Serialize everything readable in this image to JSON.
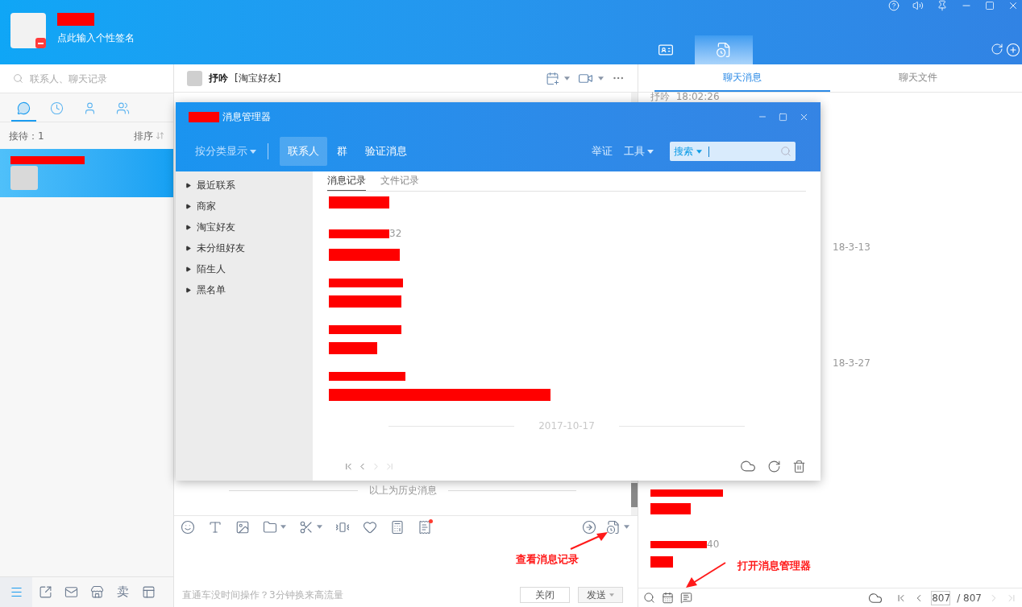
{
  "header": {
    "signature": "点此输入个性签名"
  },
  "panel_tabs": [
    {
      "kind": "card",
      "selected": false
    },
    {
      "kind": "history",
      "selected": true
    }
  ],
  "sidebar": {
    "search_placeholder": "联系人、聊天记录",
    "tabs": [
      {
        "kind": "chat",
        "selected": true
      },
      {
        "kind": "recent",
        "selected": false
      },
      {
        "kind": "contact",
        "selected": false
      },
      {
        "kind": "group",
        "selected": false
      }
    ],
    "reception": "接待：1",
    "sort": "排序",
    "conversations": [
      {
        "selected": true
      }
    ],
    "bottom_nav": [
      {
        "kind": "menu",
        "selected": true
      },
      {
        "kind": "share",
        "selected": false
      },
      {
        "kind": "mail",
        "selected": false
      },
      {
        "kind": "store",
        "selected": false
      },
      {
        "kind": "text",
        "label": "卖",
        "selected": false
      },
      {
        "kind": "panel",
        "selected": false
      }
    ]
  },
  "chat": {
    "name": "抒吟",
    "group": "[淘宝好友]",
    "history_divider": "以上为历史消息",
    "toolbar": [
      {
        "kind": "emoji",
        "menu": false
      },
      {
        "kind": "font",
        "menu": false
      },
      {
        "kind": "image",
        "menu": false
      },
      {
        "kind": "folder",
        "menu": true
      },
      {
        "kind": "screenshot",
        "menu": true
      },
      {
        "kind": "shake",
        "menu": false
      },
      {
        "kind": "favorite",
        "menu": false
      },
      {
        "kind": "calculator",
        "menu": false
      },
      {
        "kind": "coupon",
        "menu": false
      }
    ],
    "toolbar_right": [
      {
        "kind": "transfer",
        "menu": false
      },
      {
        "kind": "history",
        "menu": true
      }
    ],
    "annotation": "查看消息记录",
    "promo": "直通车没时间操作？3分钟换来高流量",
    "close": "关闭",
    "send": "发送"
  },
  "history": {
    "tabs": [
      {
        "label": "聊天消息",
        "selected": true
      },
      {
        "label": "聊天文件",
        "selected": false
      }
    ],
    "entries": [
      {
        "kind": "sender",
        "text": "抒吟  18:02:26"
      },
      {
        "kind": "date",
        "text": "18-3-13"
      },
      {
        "kind": "date",
        "text": "18-3-27"
      },
      {
        "kind": "redacted_sender"
      },
      {
        "kind": "redacted_body"
      },
      {
        "kind": "redacted_sender",
        "suffix": "40"
      },
      {
        "kind": "redacted_body"
      }
    ],
    "annotation": "打开消息管理器",
    "page": "807",
    "total": "/ 807"
  },
  "dialog": {
    "title": "消息管理器",
    "filter": "按分类显示",
    "nav": [
      {
        "label": "联系人",
        "selected": true
      },
      {
        "label": "群",
        "selected": false
      },
      {
        "label": "验证消息",
        "selected": false
      }
    ],
    "report": "举证",
    "tools": "工具",
    "search_scope": "搜索",
    "groups": [
      {
        "label": "最近联系",
        "expanded": false
      },
      {
        "label": "商家",
        "expanded": false
      },
      {
        "label": "淘宝好友",
        "expanded": false
      },
      {
        "label": "未分组好友",
        "expanded": false
      },
      {
        "label": "陌生人",
        "expanded": false
      },
      {
        "label": "黑名单",
        "expanded": false
      }
    ],
    "tabs": [
      {
        "label": "消息记录",
        "selected": true
      },
      {
        "label": "文件记录",
        "selected": false
      }
    ],
    "messages": [
      {
        "kind": "body"
      },
      {
        "kind": "sender",
        "suffix": "32"
      },
      {
        "kind": "body"
      },
      {
        "kind": "sender"
      },
      {
        "kind": "body"
      },
      {
        "kind": "sender"
      },
      {
        "kind": "body"
      },
      {
        "kind": "sender"
      },
      {
        "kind": "body"
      }
    ],
    "date": "2017-10-17"
  }
}
